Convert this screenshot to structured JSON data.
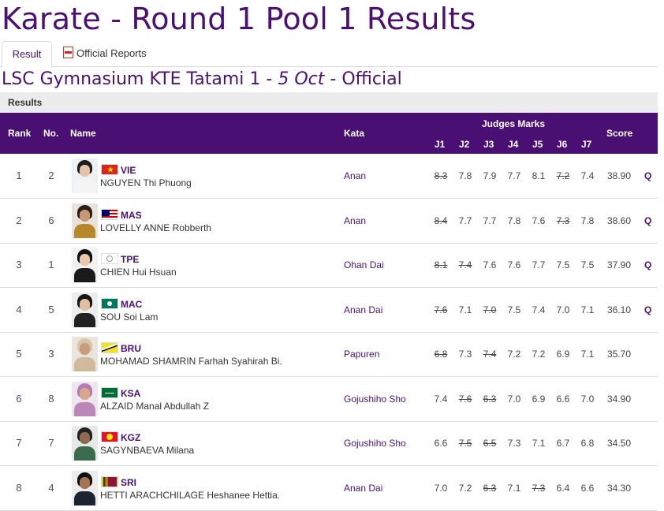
{
  "page": {
    "title": "Karate - Round 1 Pool 1 Results"
  },
  "tabs": [
    {
      "label": "Result"
    },
    {
      "label": "Official Reports"
    }
  ],
  "venue": {
    "location": "LSC Gymnasium KTE Tatami 1",
    "sep1": " - ",
    "date": "5 Oct",
    "sep2": " - ",
    "status": "Official"
  },
  "results": {
    "label": "Results",
    "headers": {
      "rank": "Rank",
      "no": "No.",
      "name": "Name",
      "kata": "Kata",
      "judges": "Judges Marks",
      "judge_cols": [
        "J1",
        "J2",
        "J3",
        "J4",
        "J5",
        "J6",
        "J7"
      ],
      "score": "Score"
    },
    "rows": [
      {
        "rank": "1",
        "no": "2",
        "noc": "VIE",
        "name": "NGUYEN Thi Phuong",
        "kata": "Anan",
        "marks": [
          {
            "v": "8.3",
            "s": true
          },
          {
            "v": "7.8",
            "s": false
          },
          {
            "v": "7.9",
            "s": false
          },
          {
            "v": "7.7",
            "s": false
          },
          {
            "v": "8.1",
            "s": false
          },
          {
            "v": "7.2",
            "s": true
          },
          {
            "v": "7.4",
            "s": false
          }
        ],
        "score": "38.90",
        "q": "Q"
      },
      {
        "rank": "2",
        "no": "6",
        "noc": "MAS",
        "name": "LOVELLY ANNE Robberth",
        "kata": "Anan",
        "marks": [
          {
            "v": "8.4",
            "s": true
          },
          {
            "v": "7.7",
            "s": false
          },
          {
            "v": "7.7",
            "s": false
          },
          {
            "v": "7.8",
            "s": false
          },
          {
            "v": "7.6",
            "s": false
          },
          {
            "v": "7.3",
            "s": true
          },
          {
            "v": "7.8",
            "s": false
          }
        ],
        "score": "38.60",
        "q": "Q"
      },
      {
        "rank": "3",
        "no": "1",
        "noc": "TPE",
        "name": "CHIEN Hui Hsuan",
        "kata": "Ohan Dai",
        "marks": [
          {
            "v": "8.1",
            "s": true
          },
          {
            "v": "7.4",
            "s": true
          },
          {
            "v": "7.6",
            "s": false
          },
          {
            "v": "7.6",
            "s": false
          },
          {
            "v": "7.7",
            "s": false
          },
          {
            "v": "7.5",
            "s": false
          },
          {
            "v": "7.5",
            "s": false
          }
        ],
        "score": "37.90",
        "q": "Q"
      },
      {
        "rank": "4",
        "no": "5",
        "noc": "MAC",
        "name": "SOU Soi Lam",
        "kata": "Anan Dai",
        "marks": [
          {
            "v": "7.6",
            "s": true
          },
          {
            "v": "7.1",
            "s": false
          },
          {
            "v": "7.0",
            "s": true
          },
          {
            "v": "7.5",
            "s": false
          },
          {
            "v": "7.4",
            "s": false
          },
          {
            "v": "7.0",
            "s": false
          },
          {
            "v": "7.1",
            "s": false
          }
        ],
        "score": "36.10",
        "q": "Q"
      },
      {
        "rank": "5",
        "no": "3",
        "noc": "BRU",
        "name": "MOHAMAD SHAMRIN Farhah Syahirah Bi.",
        "kata": "Papuren",
        "marks": [
          {
            "v": "6.8",
            "s": true
          },
          {
            "v": "7.3",
            "s": false
          },
          {
            "v": "7.4",
            "s": true
          },
          {
            "v": "7.2",
            "s": false
          },
          {
            "v": "7.2",
            "s": false
          },
          {
            "v": "6.9",
            "s": false
          },
          {
            "v": "7.1",
            "s": false
          }
        ],
        "score": "35.70",
        "q": ""
      },
      {
        "rank": "6",
        "no": "8",
        "noc": "KSA",
        "name": "ALZAID Manal Abdullah Z",
        "kata": "Gojushiho Sho",
        "marks": [
          {
            "v": "7.4",
            "s": false
          },
          {
            "v": "7.6",
            "s": true
          },
          {
            "v": "6.3",
            "s": true
          },
          {
            "v": "7.0",
            "s": false
          },
          {
            "v": "6.9",
            "s": false
          },
          {
            "v": "6.6",
            "s": false
          },
          {
            "v": "7.0",
            "s": false
          }
        ],
        "score": "34.90",
        "q": ""
      },
      {
        "rank": "7",
        "no": "7",
        "noc": "KGZ",
        "name": "SAGYNBAEVA Milana",
        "kata": "Gojushiho Sho",
        "marks": [
          {
            "v": "6.6",
            "s": false
          },
          {
            "v": "7.5",
            "s": true
          },
          {
            "v": "6.5",
            "s": true
          },
          {
            "v": "7.3",
            "s": false
          },
          {
            "v": "7.1",
            "s": false
          },
          {
            "v": "6.7",
            "s": false
          },
          {
            "v": "6.8",
            "s": false
          }
        ],
        "score": "34.50",
        "q": ""
      },
      {
        "rank": "8",
        "no": "4",
        "noc": "SRI",
        "name": "HETTI ARACHCHILAGE Heshanee Hettia.",
        "kata": "Anan Dai",
        "marks": [
          {
            "v": "7.0",
            "s": false
          },
          {
            "v": "7.2",
            "s": false
          },
          {
            "v": "6.3",
            "s": true
          },
          {
            "v": "7.1",
            "s": false
          },
          {
            "v": "7.3",
            "s": true
          },
          {
            "v": "6.4",
            "s": false
          },
          {
            "v": "6.6",
            "s": false
          }
        ],
        "score": "34.30",
        "q": ""
      }
    ]
  },
  "colors": {
    "brand": "#4a0f72",
    "header_bg": "#4a0f72",
    "results_bar": "#ececec"
  }
}
